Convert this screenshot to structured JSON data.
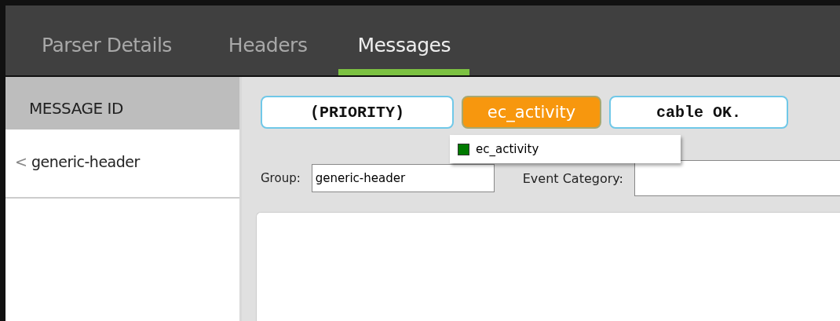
{
  "tabs": [
    {
      "label": "Parser Details",
      "selected": false
    },
    {
      "label": "Headers",
      "selected": false
    },
    {
      "label": "Messages",
      "selected": true
    }
  ],
  "sidebar": {
    "header": "MESSAGE ID",
    "items": [
      {
        "marker": "<",
        "label": "generic-header",
        "selected": false
      }
    ]
  },
  "tokens": [
    {
      "label": "(PRIORITY)",
      "kind": "literal",
      "selected": false
    },
    {
      "label": "ec_activity",
      "kind": "variable",
      "selected": true
    },
    {
      "label": "cable OK.",
      "kind": "literal",
      "selected": false
    }
  ],
  "token_menu": {
    "items": [
      {
        "label": "ec_activity",
        "color": "#007a00"
      }
    ]
  },
  "fields": [
    {
      "label": "Group:",
      "value": "generic-header"
    },
    {
      "label": "Event Category:"
    }
  ]
}
